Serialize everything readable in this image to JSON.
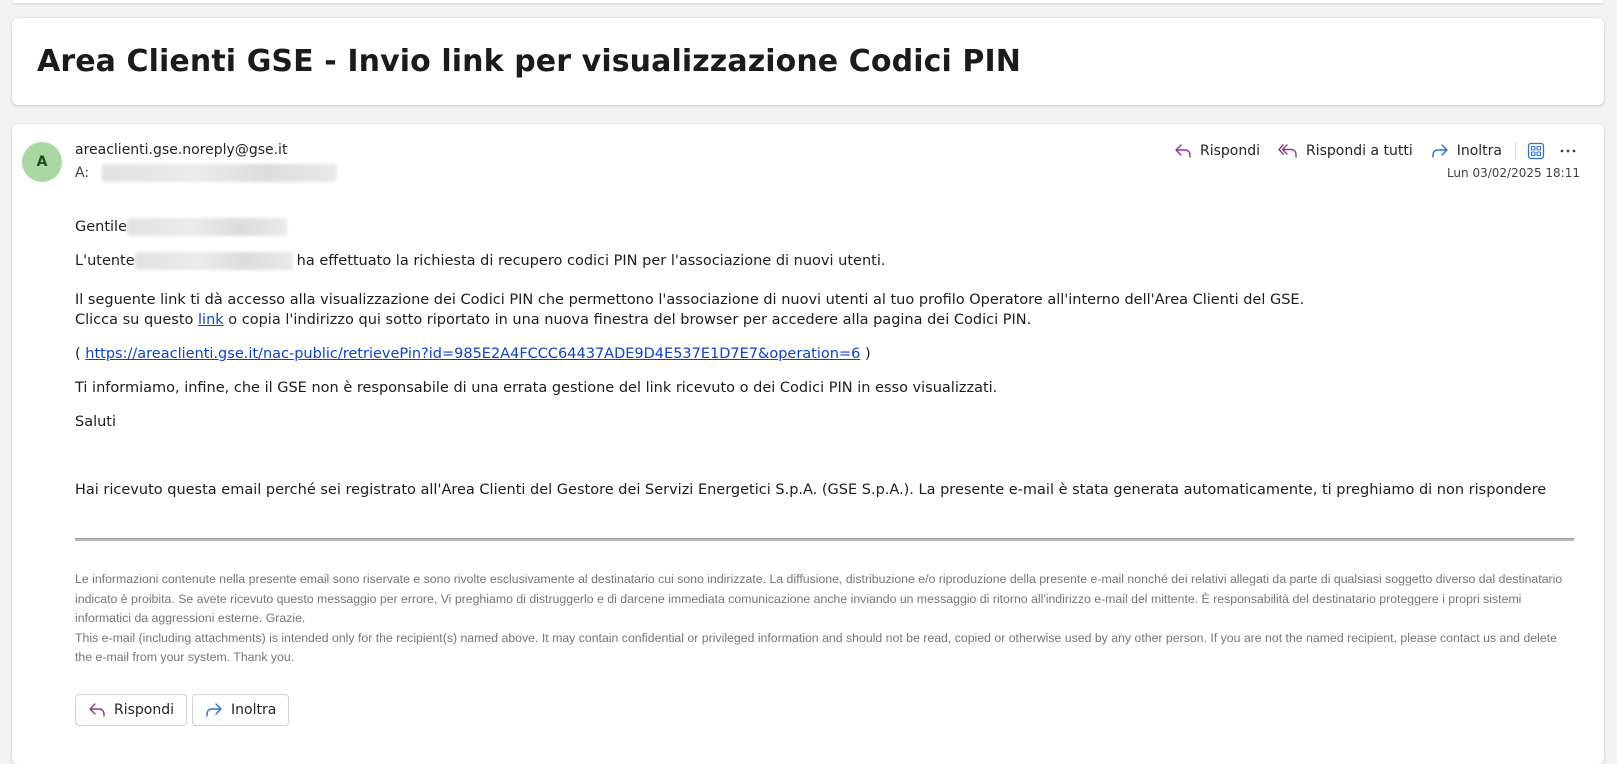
{
  "subject": "Area Clienti GSE - Invio link per visualizzazione Codici PIN",
  "message": {
    "avatar_initial": "A",
    "sender": "areaclienti.gse.noreply@gse.it",
    "to_label": "A:",
    "date": "Lun 03/02/2025 18:11",
    "actions": {
      "reply": "Rispondi",
      "reply_all": "Rispondi a tutti",
      "forward": "Inoltra"
    },
    "body": {
      "greeting": "Gentile",
      "user_prefix": "L'utente",
      "user_suffix": "ha effettuato la richiesta di recupero codici PIN per l'associazione di nuovi utenti.",
      "para1_line1": "Il seguente link ti dà accesso alla visualizzazione dei Codici PIN che permettono l'associazione di nuovi utenti al tuo profilo Operatore all'interno dell'Area Clienti del GSE.",
      "para1_line2_prefix": "Clicca su questo",
      "para1_link": "link",
      "para1_line2_suffix": "o copia l'indirizzo qui sotto riportato in una nuova finestra del browser per accedere alla pagina dei Codici PIN.",
      "url_open": "(",
      "url": "https://areaclienti.gse.it/nac-public/retrievePin?id=985E2A4FCCC64437ADE9D4E537E1D7E7&operation=6",
      "url_close": ")",
      "info": "Ti informiamo, infine, che il GSE non è responsabile di una errata gestione del link ricevuto o dei Codici PIN in esso visualizzati.",
      "closing": "Saluti",
      "notice": "Hai ricevuto questa email perché sei registrato all'Area Clienti del Gestore dei Servizi Energetici S.p.A. (GSE S.p.A.). La presente e-mail è stata generata automaticamente, ti preghiamo di non rispondere"
    },
    "disclaimer_it": "Le informazioni contenute nella presente email sono riservate e sono rivolte esclusivamente al destinatario cui sono indirizzate. La diffusione, distribuzione e/o riproduzione della presente e-mail nonché dei relativi allegati da parte di qualsiasi soggetto diverso dal destinatario indicato è proibita. Se avete ricevuto questo messaggio per errore, Vi preghiamo di distruggerlo e di darcene immediata comunicazione anche inviando un messaggio di ritorno all'indirizzo e-mail del mittente. È responsabilità del destinatario proteggere i propri sistemi informatici da aggressioni esterne. Grazie.",
    "disclaimer_en": "This e-mail (including attachments) is intended only for the recipient(s) named above. It may contain confidential or privileged information and should not be read, copied or otherwise used by any other person. If you are not the named recipient, please contact us and delete the e-mail from your system. Thank you.",
    "bottom_actions": {
      "reply": "Rispondi",
      "forward": "Inoltra"
    }
  },
  "icons": {
    "reply": "reply-arrow-icon",
    "reply_all": "reply-all-arrow-icon",
    "forward": "forward-arrow-icon",
    "view": "immersive-reader-icon",
    "more": "more-ellipsis-icon"
  },
  "colors": {
    "reply_icon": "#8a3a8f",
    "forward_icon": "#2b72d8",
    "link": "#0b3fd6",
    "avatar_bg": "#a9d8a3"
  }
}
